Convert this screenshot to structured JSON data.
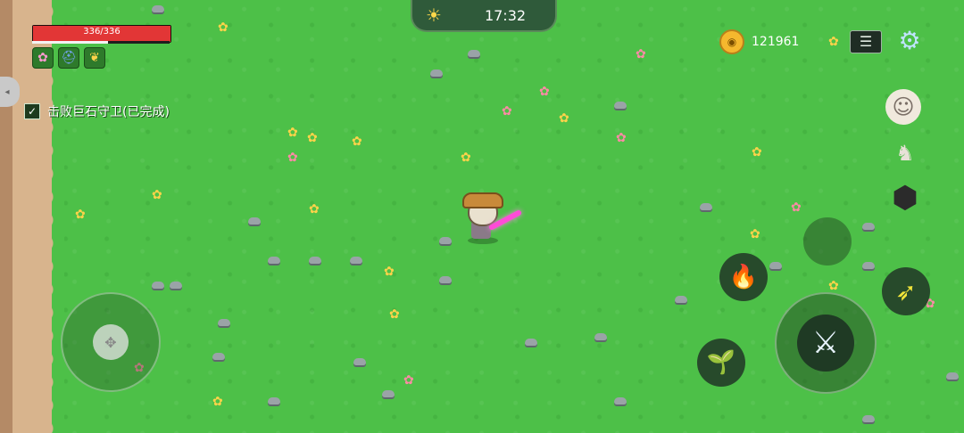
{
  "hud": {
    "hp": {
      "current": 336,
      "max": 336,
      "text": "336/336",
      "fill_fraction": 1.0
    },
    "xp": {
      "fill_fraction": 0.55
    },
    "buffs": [
      {
        "icon": "flower-buff-icon",
        "glyph": "✿"
      },
      {
        "icon": "helmet-buff-icon",
        "glyph": "⛑"
      },
      {
        "icon": "plant-buff-icon",
        "glyph": "❦"
      }
    ],
    "quest": {
      "checked": "✓",
      "text": "击败巨石守卫(已完成)"
    },
    "side_tab_icon": "arrow-icon"
  },
  "top": {
    "weather_icon": "sun-icon",
    "weather_glyph": "☀",
    "time": "17:32"
  },
  "currency": {
    "icon": "coin-icon",
    "glyph": "◉",
    "amount": "121961"
  },
  "menu": {
    "menu_icon": "menu-icon",
    "menu_glyph": "☰",
    "settings_icon": "gear-icon",
    "settings_glyph": "⚙"
  },
  "side_buttons": [
    {
      "name": "companion-portrait",
      "glyph": "☺"
    },
    {
      "name": "pet-portrait",
      "glyph": "♞"
    },
    {
      "name": "dungeon-portal",
      "glyph": "⬢"
    }
  ],
  "controls": {
    "joystick_glyph": "✥",
    "campfire_glyph": "🔥",
    "plant_glyph": "🌱",
    "attack_glyph": "⚔",
    "dash_glyph": "➶"
  },
  "colors": {
    "grass": "#4dc048",
    "hp": "#e23636",
    "path": "#d8b48d",
    "sword": "#ff4bd7"
  }
}
